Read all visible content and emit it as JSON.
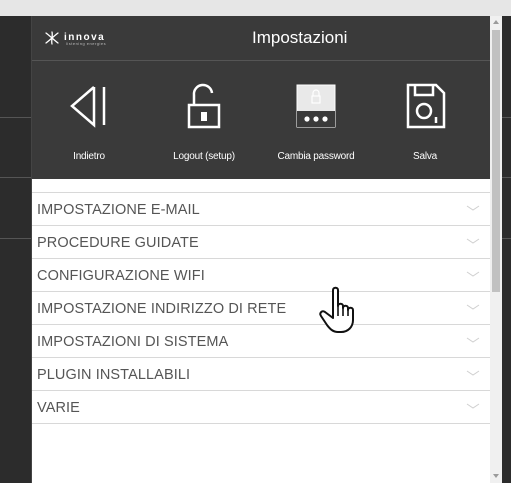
{
  "header": {
    "logo": "innova",
    "logo_sub": "listening energies",
    "title": "Impostazioni"
  },
  "toolbar": {
    "items": [
      {
        "label": "Indietro",
        "icon": "back-icon"
      },
      {
        "label": "Logout (setup)",
        "icon": "unlock-icon"
      },
      {
        "label": "Cambia password",
        "icon": "password-icon"
      },
      {
        "label": "Salva",
        "icon": "save-icon"
      }
    ]
  },
  "menu": {
    "items": [
      {
        "label": "IMPOSTAZIONE E-MAIL"
      },
      {
        "label": "PROCEDURE GUIDATE"
      },
      {
        "label": "CONFIGURAZIONE WIFI"
      },
      {
        "label": "IMPOSTAZIONE INDIRIZZO DI RETE"
      },
      {
        "label": "IMPOSTAZIONI DI SISTEMA"
      },
      {
        "label": "PLUGIN INSTALLABILI"
      },
      {
        "label": "VARIE"
      }
    ]
  },
  "colors": {
    "header_bg": "#3a3a3a",
    "menu_text": "#555555",
    "divider": "#d8d8d8"
  }
}
